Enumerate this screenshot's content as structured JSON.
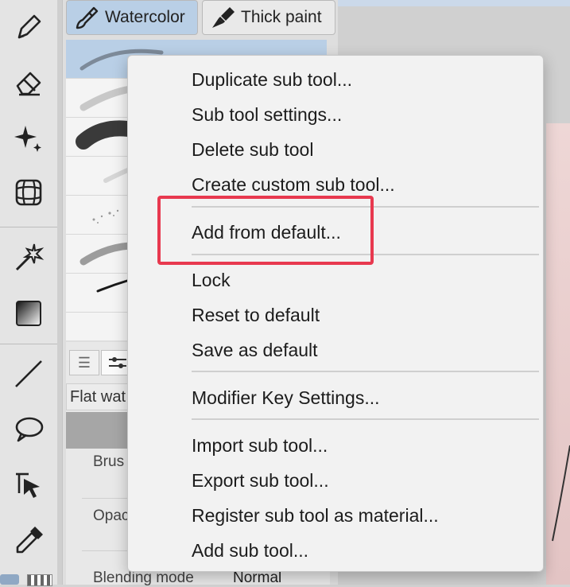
{
  "sub_tool_tabs": [
    {
      "label": "Watercolor",
      "icon": "watercolor-brush-icon",
      "active": true
    },
    {
      "label": "Thick paint",
      "icon": "thick-paint-brush-icon",
      "active": false
    }
  ],
  "tools": [
    "pen-icon",
    "eraser-icon",
    "sparkle-icon",
    "perspective-ruler-icon",
    "auto-select-wand-icon",
    "gradient-icon",
    "line-tool-icon",
    "lasso-icon",
    "operation-cursor-icon",
    "eyedropper-icon"
  ],
  "property_panel": {
    "brush_name": "Flat wat",
    "brush_size_label": "Brus",
    "opacity_label": "Opac",
    "blending_mode_label": "Blending mode",
    "blending_mode_value": "Normal"
  },
  "context_menu": {
    "groups": [
      [
        "Duplicate sub tool...",
        "Sub tool settings...",
        "Delete sub tool",
        "Create custom sub tool..."
      ],
      [
        "Add from default..."
      ],
      [
        "Lock",
        "Reset to default",
        "Save as default"
      ],
      [
        "Modifier Key Settings..."
      ],
      [
        "Import sub tool...",
        "Export sub tool...",
        "Register sub tool as material...",
        "Add sub tool..."
      ]
    ],
    "highlight_color": "#e8394f"
  }
}
